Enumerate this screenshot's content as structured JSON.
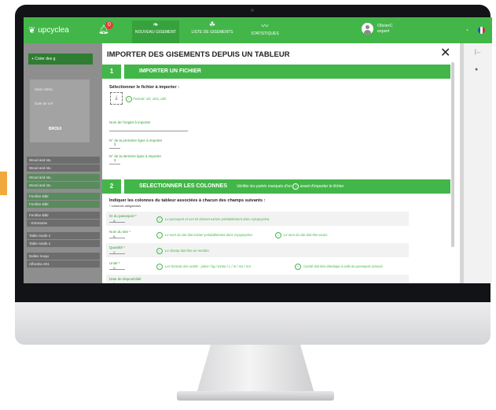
{
  "topbar": {
    "logo": "upcyclea",
    "notification_count": "0",
    "nav": [
      {
        "label": "NOUVEAU GISEMENT",
        "icon": "leaf-outline-icon"
      },
      {
        "label": "LISTE DE GISEMENTS",
        "icon": "leaves-icon"
      },
      {
        "label": "STATISTIQUES",
        "icon": "chart-line-icon"
      }
    ],
    "user_name": "OlivierC",
    "user_role": "expert"
  },
  "background": {
    "create_button": "+ Créer des g",
    "field_1": "Sans catéq",
    "field_2": "Date de cré",
    "card_label": "BROUI",
    "rows": [
      "Wood and stu",
      "Wood and stu",
      "Wood and stu",
      "Wood and stu",
      "Fenêtre Bâti",
      "Fenêtre Bâti",
      "Fenêtre Bâti",
      "- Entretoise",
      "Table ronde s",
      "Table ronde s",
      "Dalles moqu",
      "Affordna 201"
    ]
  },
  "modal": {
    "title": "IMPORTER DES GISEMENTS DEPUIS UN TABLEUR",
    "section1": {
      "number": "1",
      "title": "IMPORTER UN FICHIER",
      "select_label": "Sélectionner le fichier à importer :",
      "format_hint": "Format: xls, xlsx, ods",
      "sheet_label": "Nom de l'onglet à importer",
      "first_row_label": "N° de la première ligne à importer",
      "last_row_label": "N° de la dernière ligne à importer",
      "first_row_value": "2",
      "last_row_value": "2"
    },
    "section2": {
      "number": "2",
      "title": "SELECTIONNER LES COLONNES",
      "note": "Vérifier les points marqués d'un",
      "note_after": "avant d'importer le fichier.",
      "instruction": "Indiquer les colonnes du tableur associées à chacun des champs suivants :",
      "required_note": "* colonnes obligatoires",
      "rows": [
        {
          "label": "ID du passeport *",
          "value": "A",
          "hint": "Le passeport et son ID doivent exister préalablement dans myUpcyclea.",
          "hint2": ""
        },
        {
          "label": "Nom du site *",
          "value": "B",
          "hint": "Le nom du site doit exister préalablement dans myUpcyclea",
          "hint2": "Le nom du site doit être exact."
        },
        {
          "label": "Quantité *",
          "value": "C",
          "hint": "Le champ doit être un nombre.",
          "hint2": ""
        },
        {
          "label": "Unité *",
          "value": "D",
          "hint": "Les formats des unités : pièce / kg / tonne / L / m / m2 / m3",
          "hint2": "Cunité doit être identique à celle du passeport associé."
        },
        {
          "label": "Date de disponibilité",
          "value": "E",
          "hint": "",
          "hint2": ""
        }
      ]
    },
    "close_icon": "close-icon"
  },
  "colors": {
    "accent_green": "#43b649",
    "dark_green": "#2e9e35",
    "orange_tab": "#f2a93b"
  }
}
